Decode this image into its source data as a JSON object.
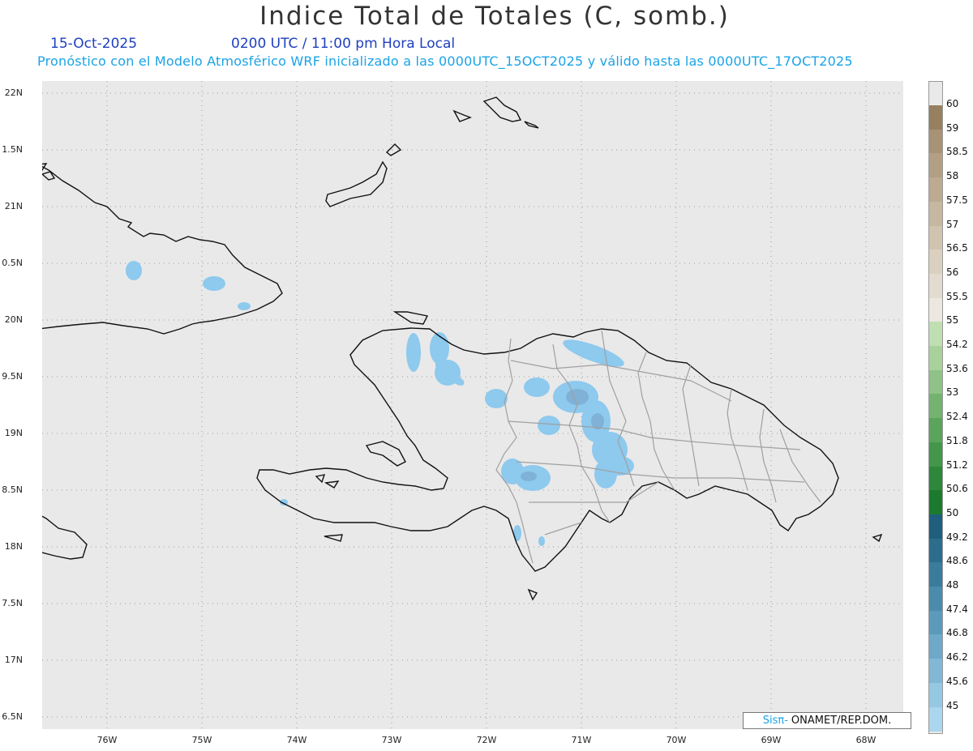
{
  "header": {
    "title": "Indice Total de Totales (C, somb.)",
    "date": "15-Oct-2025",
    "time": "0200 UTC / 11:00 pm Hora Local",
    "model_line": "Pronóstico con el Modelo Atmosférico WRF inicializado a las 0000UTC_15OCT2025 y válido hasta las  0000UTC_17OCT2025"
  },
  "map": {
    "lat_labels": [
      "22N",
      "1.5N",
      "21N",
      "0.5N",
      "20N",
      "9.5N",
      "19N",
      "8.5N",
      "18N",
      "7.5N",
      "17N",
      "6.5N"
    ],
    "lon_labels": [
      "76W",
      "75W",
      "74W",
      "73W",
      "72W",
      "71W",
      "70W",
      "69W",
      "68W"
    ],
    "background_color": "#e9e9e9",
    "shading_color": "#8ec9ee"
  },
  "colorbar": {
    "labels": [
      "60",
      "59",
      "58.5",
      "58",
      "57.5",
      "57",
      "56.5",
      "56",
      "55.5",
      "55",
      "54.2",
      "53.6",
      "53",
      "52.4",
      "51.8",
      "51.2",
      "50.6",
      "50",
      "49.2",
      "48.6",
      "48",
      "47.4",
      "46.8",
      "46.2",
      "45.6",
      "45"
    ],
    "colors": [
      "#968060",
      "#a89276",
      "#b3a084",
      "#bcab91",
      "#c6b7a0",
      "#d0c3af",
      "#dad0c0",
      "#e3dbcf",
      "#ece7df",
      "#bfdfb3",
      "#a8d19c",
      "#8ec286",
      "#73b36f",
      "#5aa45b",
      "#43964a",
      "#2e873b",
      "#1c7a2f",
      "#1f5e7d",
      "#2c6d8e",
      "#3b7c9d",
      "#4b8bac",
      "#5c9abb",
      "#6ea9c9",
      "#81b8d6",
      "#95c8e3",
      "#aad6ee"
    ]
  },
  "credit": {
    "sis": "Sisπ‐",
    "org": " ONAMET/REP.DOM."
  }
}
